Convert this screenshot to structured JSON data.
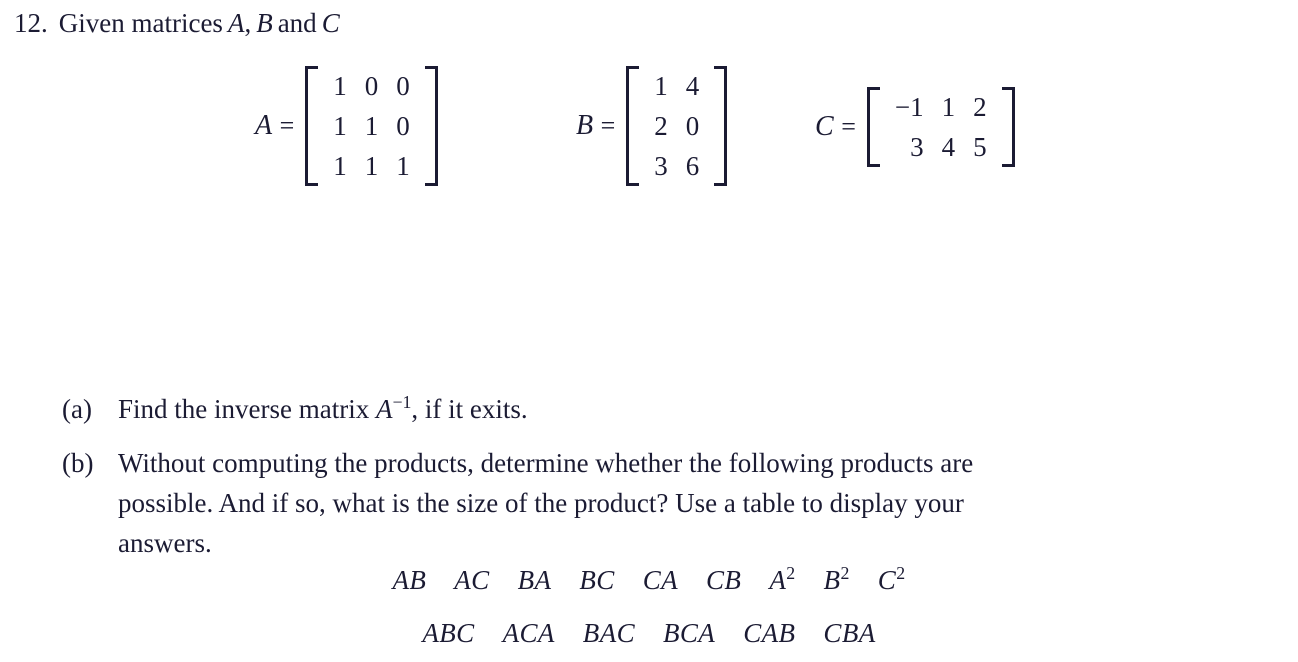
{
  "document": {
    "problem_number": "12.",
    "statement_prefix": "Given matrices",
    "statement_vars": [
      "A",
      "B",
      "C"
    ],
    "statement_full": "12. Given matrices A, B and C",
    "comma": ",",
    "and_word": "and"
  },
  "matrices": [
    {
      "label": "A",
      "equals": "=",
      "rows": [
        [
          "1",
          "0",
          "0"
        ],
        [
          "1",
          "1",
          "0"
        ],
        [
          "1",
          "1",
          "1"
        ]
      ],
      "size": "3x3",
      "align": "center"
    },
    {
      "label": "B",
      "equals": "=",
      "rows": [
        [
          "1",
          "4"
        ],
        [
          "2",
          "0"
        ],
        [
          "3",
          "6"
        ]
      ],
      "size": "3x2",
      "align": "center"
    },
    {
      "label": "C",
      "equals": "=",
      "rows": [
        [
          "−1",
          "1",
          "2"
        ],
        [
          "3",
          "4",
          "5"
        ]
      ],
      "size": "2x3",
      "align": "right"
    }
  ],
  "parts": [
    {
      "tag": "(a)",
      "text_before": "Find the inverse matrix ",
      "math_base": "A",
      "math_exp": "−1",
      "text_after": ", if it exits."
    },
    {
      "tag": "(b)",
      "lines": [
        "Without computing the products, determine whether the following products are",
        "possible. And if so, what is the size of the product? Use a table to display your",
        "answers."
      ]
    }
  ],
  "product_lists": [
    {
      "items": [
        {
          "base": "AB",
          "exp": ""
        },
        {
          "base": "AC",
          "exp": ""
        },
        {
          "base": "BA",
          "exp": ""
        },
        {
          "base": "BC",
          "exp": ""
        },
        {
          "base": "CA",
          "exp": ""
        },
        {
          "base": "CB",
          "exp": ""
        },
        {
          "base": "A",
          "exp": "2"
        },
        {
          "base": "B",
          "exp": "2"
        },
        {
          "base": "C",
          "exp": "2"
        }
      ]
    },
    {
      "items": [
        {
          "base": "ABC",
          "exp": ""
        },
        {
          "base": "ACA",
          "exp": ""
        },
        {
          "base": "BAC",
          "exp": ""
        },
        {
          "base": "BCA",
          "exp": ""
        },
        {
          "base": "CAB",
          "exp": ""
        },
        {
          "base": "CBA",
          "exp": ""
        }
      ]
    }
  ],
  "colors": {
    "background": "#ffffff",
    "text": "#1b1b33"
  }
}
